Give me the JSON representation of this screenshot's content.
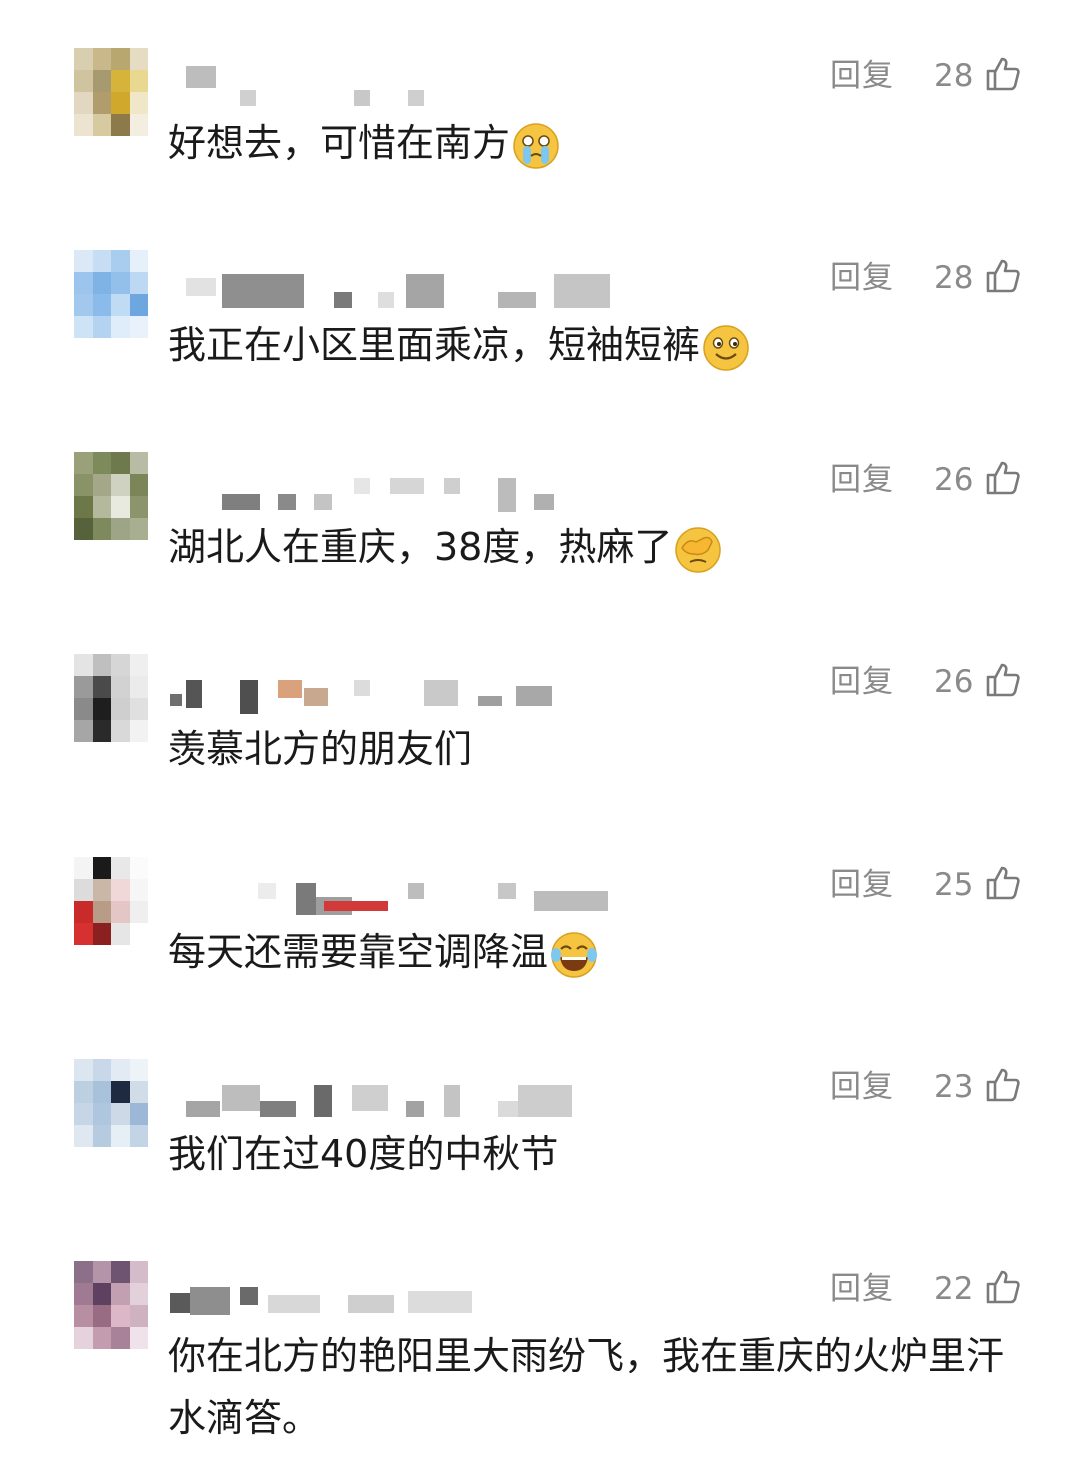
{
  "reply_label": "回复",
  "comments": [
    {
      "likes": "28",
      "text": "好想去，可惜在南方",
      "emoji": "crying-face"
    },
    {
      "likes": "28",
      "text": "我正在小区里面乘凉，短袖短裤",
      "emoji": "smiling-face"
    },
    {
      "likes": "26",
      "text": "湖北人在重庆，38度，热麻了",
      "emoji": "facepalm-face"
    },
    {
      "likes": "26",
      "text": "羡慕北方的朋友们",
      "emoji": ""
    },
    {
      "likes": "25",
      "text": "每天还需要靠空调降温",
      "emoji": "tears-of-joy-face"
    },
    {
      "likes": "23",
      "text": "我们在过40度的中秋节",
      "emoji": ""
    },
    {
      "likes": "22",
      "text": "你在北方的艳阳里大雨纷飞，我在重庆的火炉里汗水滴答。",
      "emoji": ""
    }
  ],
  "icons": {
    "like": "thumbs-up-icon"
  },
  "colors": {
    "meta_text": "#8a8a8a",
    "body_text": "#1a1a1a"
  }
}
